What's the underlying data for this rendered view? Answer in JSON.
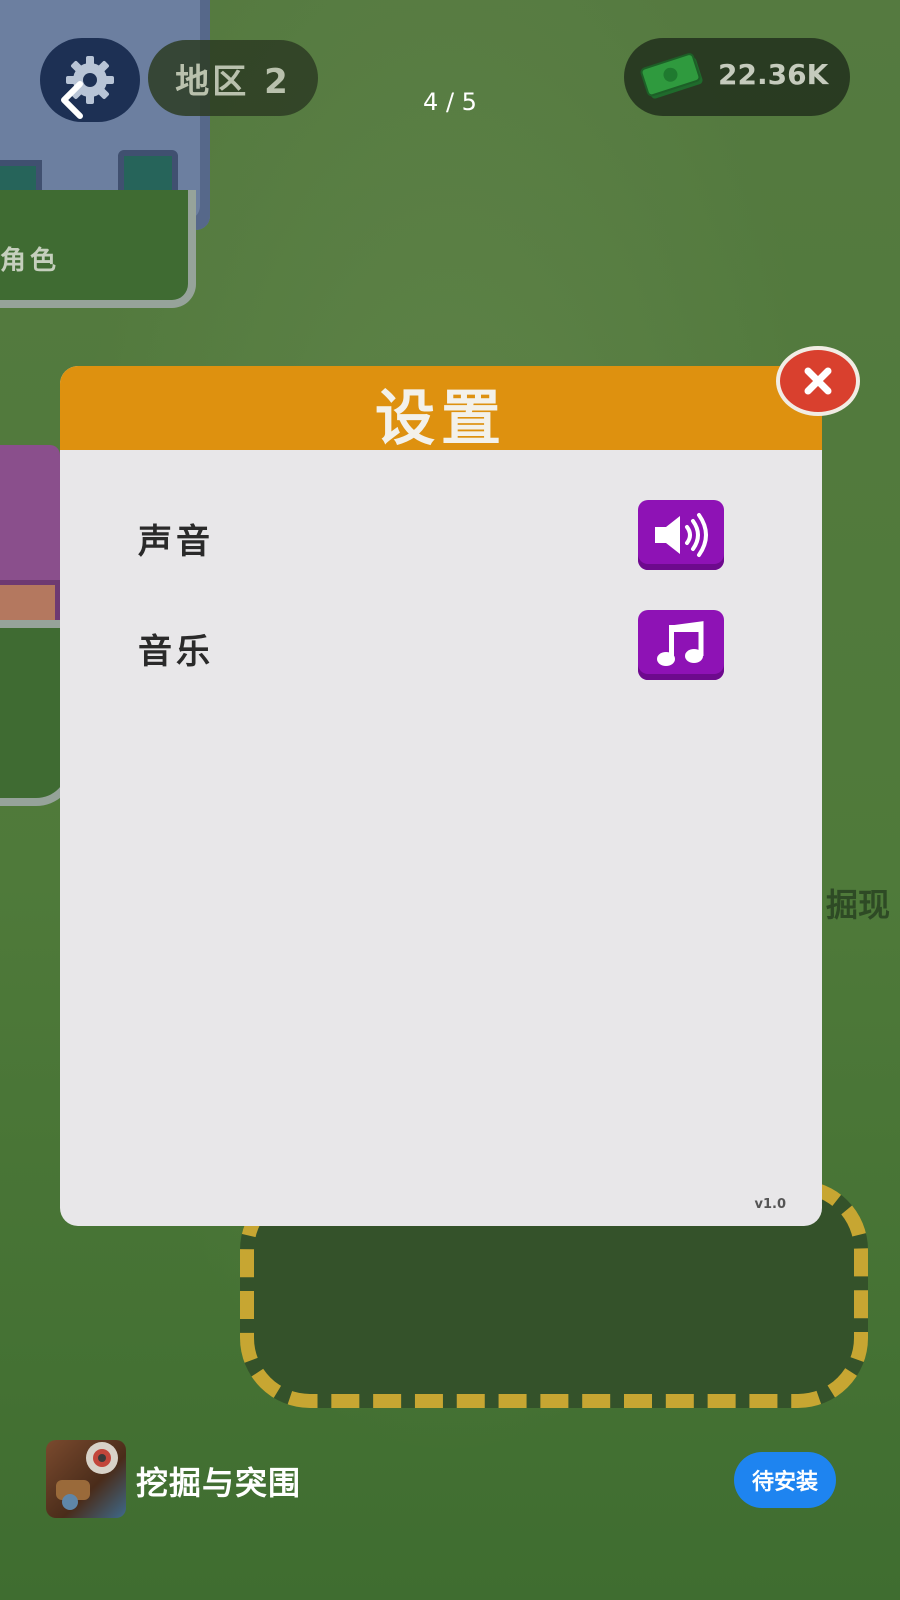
{
  "scene": {
    "building_label": "角色",
    "side_text": "掘现"
  },
  "hud": {
    "settings_icon": "gear-icon",
    "back_icon": "chevron-left-icon",
    "region_label": "地区 2",
    "page_indicator": "4 / 5",
    "currency_icon": "cash-icon",
    "currency_value": "22.36K"
  },
  "dialog": {
    "title": "设置",
    "close_icon": "close-icon",
    "rows": [
      {
        "label": "声音",
        "icon": "speaker-icon"
      },
      {
        "label": "音乐",
        "icon": "music-note-icon"
      }
    ],
    "version": "v1.0",
    "colors": {
      "header": "#de910f",
      "toggle": "#8e12b5",
      "close": "#d9402e"
    }
  },
  "ad": {
    "app_name": "挖掘与突围",
    "install_label": "待安装",
    "accent": "#1e84f0"
  }
}
